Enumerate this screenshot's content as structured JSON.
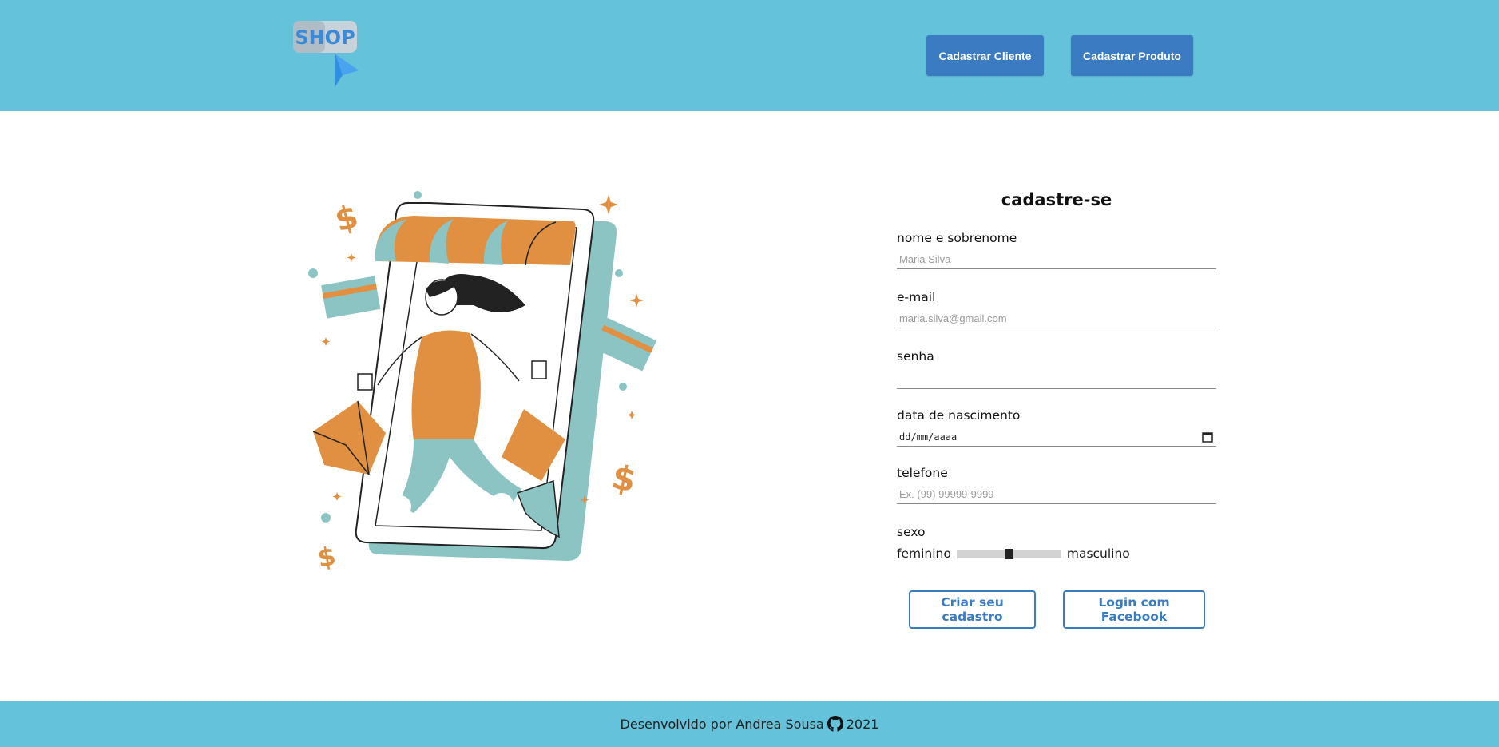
{
  "header": {
    "logo_text": "SHOP",
    "nav": [
      {
        "label": "Cadastrar Cliente"
      },
      {
        "label": "Cadastrar Produto"
      }
    ]
  },
  "form": {
    "title": "cadastre-se",
    "fields": [
      {
        "label": "nome e sobrenome",
        "placeholder": "Maria Silva"
      },
      {
        "label": "e-mail",
        "placeholder": "maria.silva@gmail.com"
      },
      {
        "label": "senha",
        "placeholder": ""
      },
      {
        "label": "data de nascimento",
        "value": "dd/mm/aaaa"
      },
      {
        "label": "telefone",
        "placeholder": "Ex. (99) 99999-9999"
      }
    ],
    "sexo": {
      "label": "sexo",
      "left": "feminino",
      "right": "masculino",
      "value": 0.5
    },
    "buttons": {
      "criar": "Criar seu cadastro",
      "facebook": "Login com Facebook"
    }
  },
  "footer": {
    "prefix": "Desenvolvido por Andrea Sousa",
    "year": "2021"
  },
  "colors": {
    "primary_bg": "#64c2db",
    "button_blue": "#3a7bc2",
    "accent_orange": "#e09040",
    "accent_teal": "#8cc4c4"
  },
  "icons": [
    "shop-logo",
    "calendar-icon",
    "github-icon"
  ]
}
